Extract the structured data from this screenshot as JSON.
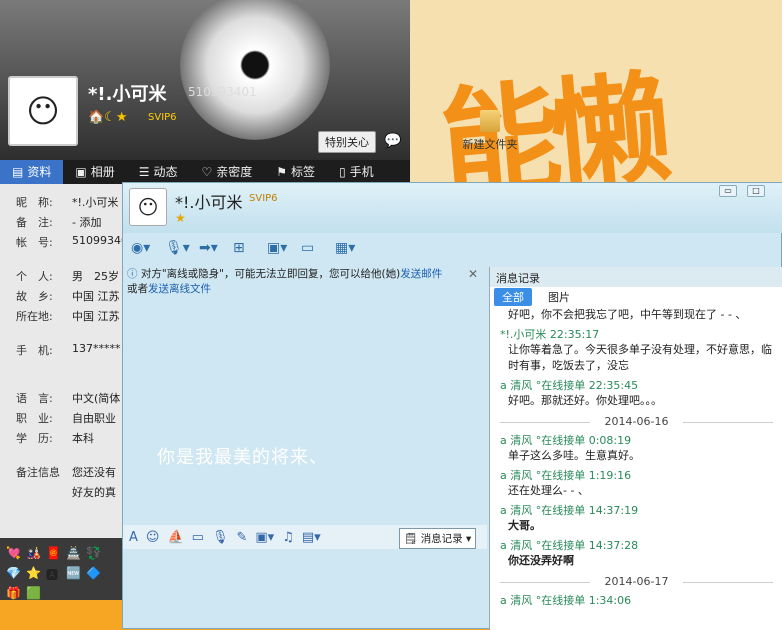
{
  "desktop": {
    "art_text": "能懒",
    "folder_label": "新建文件夹"
  },
  "profile": {
    "name": "*!.小可米",
    "qq": "510993401",
    "svip": "SVIP6",
    "care_btn": "特别关心",
    "tabs": [
      "资料",
      "相册",
      "动态",
      "亲密度",
      "标签",
      "手机"
    ],
    "fields": [
      {
        "k": "昵　称:",
        "v": "*!.小可米"
      },
      {
        "k": "备　注:",
        "v": "- 添加"
      },
      {
        "k": "帐　号:",
        "v": "510993401"
      },
      {
        "k": "个　人:",
        "v": "男　25岁"
      },
      {
        "k": "故　乡:",
        "v": "中国 江苏"
      },
      {
        "k": "所在地:",
        "v": "中国 江苏"
      },
      {
        "k": "手　机:",
        "v": "137*****"
      },
      {
        "k": "语　言:",
        "v": "中文(简体"
      },
      {
        "k": "职　业:",
        "v": "自由职业"
      },
      {
        "k": "学　历:",
        "v": "本科"
      },
      {
        "k": "备注信息",
        "v": "您还没有"
      },
      {
        "k": "",
        "v": "好友的真"
      }
    ]
  },
  "chat": {
    "name": "*!.小可米",
    "svip": "SVIP6",
    "notice_pre": "对方\"离线或隐身\"，可能无法立即回复，您可以给他(她)",
    "notice_link1": "发送邮件",
    "notice_mid": "或者",
    "notice_link2": "发送离线文件",
    "signature": "你是我最美的将来、",
    "history_btn": "消息记录",
    "history": {
      "title": "消息记录",
      "tabs": [
        "全部",
        "图片"
      ],
      "messages": [
        {
          "type": "text",
          "body": "好吧，你不会把我忘了吧，中午等到现在了 - - 、"
        },
        {
          "type": "head",
          "body": "*!.小可米 22:35:17"
        },
        {
          "type": "text",
          "body": "让你等着急了。今天很多单子没有处理，不好意思，临时有事，吃饭去了，没忘"
        },
        {
          "type": "head",
          "body": "a 清风 °在线接单 22:35:45"
        },
        {
          "type": "text",
          "body": "好吧。那就还好。你处理吧。。。"
        },
        {
          "type": "date",
          "body": "2014-06-16"
        },
        {
          "type": "head",
          "body": "a 清风 °在线接单 0:08:19"
        },
        {
          "type": "text",
          "body": "单子这么多哇。生意真好。"
        },
        {
          "type": "head",
          "body": "a 清风 °在线接单 1:19:16"
        },
        {
          "type": "text",
          "body": "还在处理么- - 、"
        },
        {
          "type": "head",
          "body": "a 清风 °在线接单 14:37:19"
        },
        {
          "type": "bold",
          "body": "大哥。"
        },
        {
          "type": "head",
          "body": "a 清风 °在线接单 14:37:28"
        },
        {
          "type": "bold",
          "body": "你还没弄好啊"
        },
        {
          "type": "date",
          "body": "2014-06-17"
        },
        {
          "type": "head",
          "body": "a 清风 °在线接单 1:34:06"
        }
      ]
    }
  }
}
